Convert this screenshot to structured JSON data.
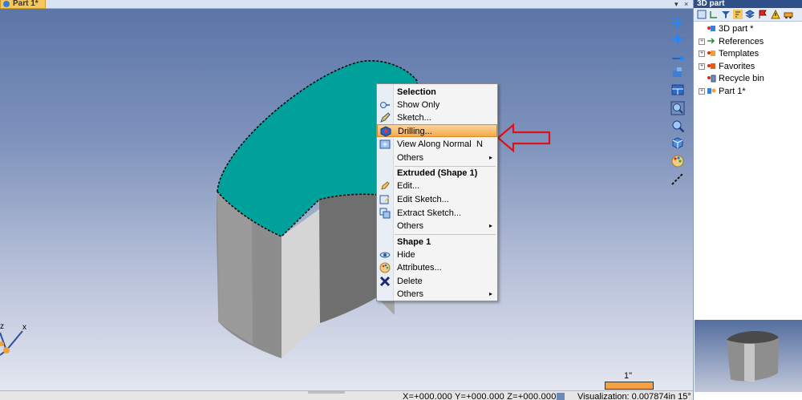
{
  "document_tab": {
    "label": "Part 1*"
  },
  "tabstrip_controls": {
    "pin": "▾",
    "close": "×"
  },
  "context_menu": {
    "sections": [
      {
        "header": "Selection",
        "items": [
          {
            "label": "Show Only",
            "icon": "show-only-icon"
          },
          {
            "label": "Sketch...",
            "icon": "pencil-icon"
          },
          {
            "label": "Drilling...",
            "icon": "drilling-icon",
            "highlighted": true
          },
          {
            "label": "View Along Normal",
            "shortcut": "N",
            "icon": "view-normal-icon"
          },
          {
            "label": "Others",
            "submenu": true
          }
        ]
      },
      {
        "header": "Extruded (Shape 1)",
        "items": [
          {
            "label": "Edit...",
            "icon": "edit-icon"
          },
          {
            "label": "Edit Sketch...",
            "icon": "edit-sketch-icon"
          },
          {
            "label": "Extract Sketch...",
            "icon": "extract-sketch-icon"
          },
          {
            "label": "Others",
            "submenu": true
          }
        ]
      },
      {
        "header": "Shape 1",
        "items": [
          {
            "label": "Hide",
            "icon": "hide-icon"
          },
          {
            "label": "Attributes...",
            "icon": "palette-icon"
          },
          {
            "label": "Delete",
            "icon": "delete-x-icon"
          },
          {
            "label": "Others",
            "submenu": true
          }
        ]
      }
    ]
  },
  "right_panel": {
    "title": "3D part",
    "tree": [
      {
        "label": "3D part *",
        "expander": "",
        "icon": "part-root-icon"
      },
      {
        "label": "References",
        "expander": "+",
        "icon": "references-icon"
      },
      {
        "label": "Templates",
        "expander": "+",
        "icon": "templates-icon"
      },
      {
        "label": "Favorites",
        "expander": "+",
        "icon": "favorites-icon"
      },
      {
        "label": "Recycle bin",
        "expander": "",
        "icon": "recycle-bin-icon"
      },
      {
        "label": "Part 1*",
        "expander": "+",
        "icon": "part-icon"
      }
    ]
  },
  "viewport": {
    "scale_label": "1\"",
    "axis_label_x": "x",
    "axis_label_z": "z"
  },
  "statusbar": {
    "coordinates": "X=+000.000  Y=+000.000  Z=+000.000",
    "visualization": "Visualization: 0.007874in 15°"
  },
  "colors": {
    "selected_face": "#00a19b",
    "highlight": "#f3a94c",
    "annotation_arrow": "#e0101a",
    "scale_bar": "#f5a141"
  }
}
